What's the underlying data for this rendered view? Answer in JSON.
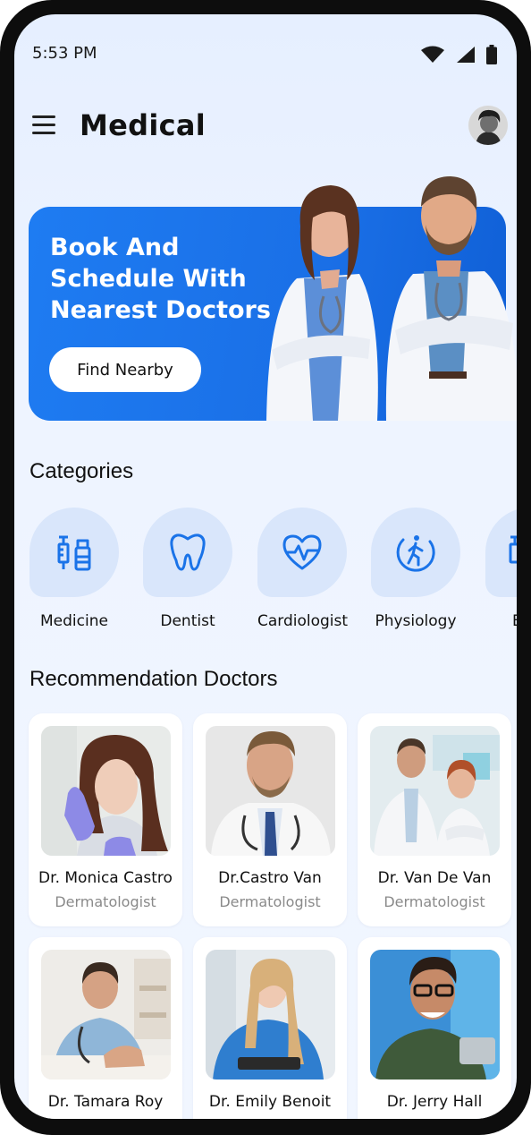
{
  "status_bar": {
    "time": "5:53 PM",
    "icons": [
      "wifi-icon",
      "cellular-signal-icon",
      "battery-icon"
    ]
  },
  "app_bar": {
    "title": "Medical",
    "menu_icon": "hamburger-menu-icon",
    "avatar": "profile-avatar"
  },
  "banner": {
    "line1": "Book And",
    "line2": "Schedule With",
    "line3": "Nearest Doctors",
    "button_label": "Find Nearby"
  },
  "categories": {
    "title": "Categories",
    "items": [
      {
        "label": "Medicine",
        "icon": "medicine-icon"
      },
      {
        "label": "Dentist",
        "icon": "tooth-icon"
      },
      {
        "label": "Cardiologist",
        "icon": "heart-pulse-icon"
      },
      {
        "label": "Physiology",
        "icon": "physiology-icon"
      },
      {
        "label": "B",
        "icon": "medicine-icon"
      }
    ]
  },
  "recommendation": {
    "title": "Recommendation Doctors",
    "doctors": [
      {
        "name": "Dr. Monica Castro",
        "specialty": "Dermatologist"
      },
      {
        "name": "Dr.Castro Van",
        "specialty": "Dermatologist"
      },
      {
        "name": "Dr. Van De Van",
        "specialty": "Dermatologist"
      },
      {
        "name": "Dr. Tamara Roy",
        "specialty": ""
      },
      {
        "name": "Dr. Emily Benoit",
        "specialty": ""
      },
      {
        "name": "Dr. Jerry Hall",
        "specialty": ""
      }
    ]
  },
  "colors": {
    "accent": "#1e7cf2",
    "icon_blue": "#1a73e8",
    "category_bg": "#d9e6fb",
    "screen_bg": "#eef4ff"
  }
}
